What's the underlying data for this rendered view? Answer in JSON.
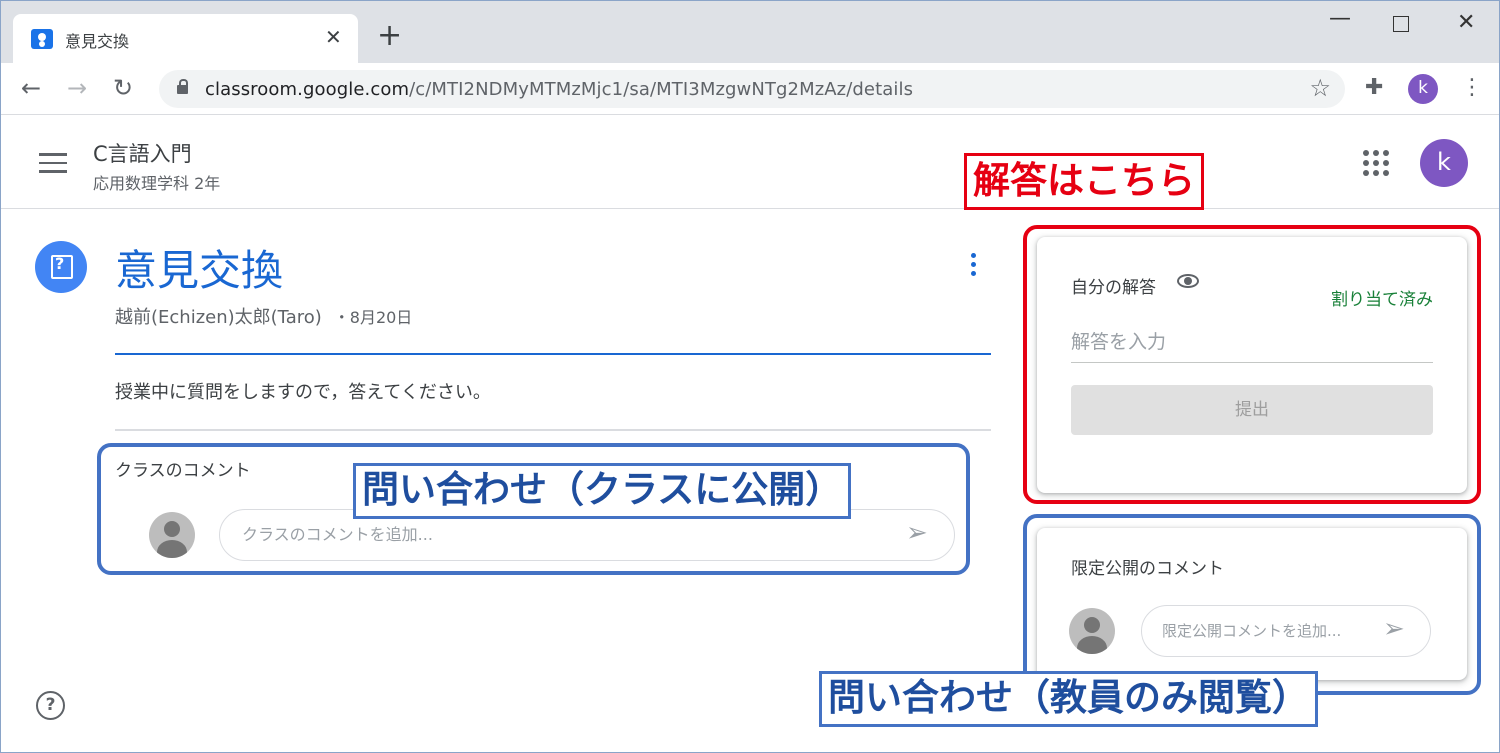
{
  "browser": {
    "tab_title": "意見交換",
    "url_domain": "classroom.google.com",
    "url_path": "/c/MTI2NDMyMTMzMjc1/sa/MTI3MzgwNTg2MzAz/details",
    "profile_initial": "k"
  },
  "header": {
    "course_title": "C言語入門",
    "course_subtitle": "応用数理学科 2年",
    "profile_initial": "k"
  },
  "post": {
    "title": "意見交換",
    "author": "越前(Echizen)太郎(Taro)",
    "date": "・8月20日",
    "body": "授業中に質問をしますので，答えてください。"
  },
  "class_comments": {
    "label": "クラスのコメント",
    "placeholder": "クラスのコメントを追加..."
  },
  "answer_card": {
    "label": "自分の解答",
    "status": "割り当て済み",
    "input_placeholder": "解答を入力",
    "submit_label": "提出"
  },
  "private_comments": {
    "label": "限定公開のコメント",
    "placeholder": "限定公開コメントを追加..."
  },
  "annotations": {
    "answer_here": "解答はこちら",
    "class_inquiry": "問い合わせ（クラスに公開）",
    "private_inquiry": "問い合わせ（教員のみ閲覧）"
  },
  "colors": {
    "accent_blue": "#1967d2",
    "annotation_red": "#e60012",
    "annotation_blue": "#4472c4",
    "status_green": "#188038",
    "avatar_purple": "#7e57c2"
  }
}
